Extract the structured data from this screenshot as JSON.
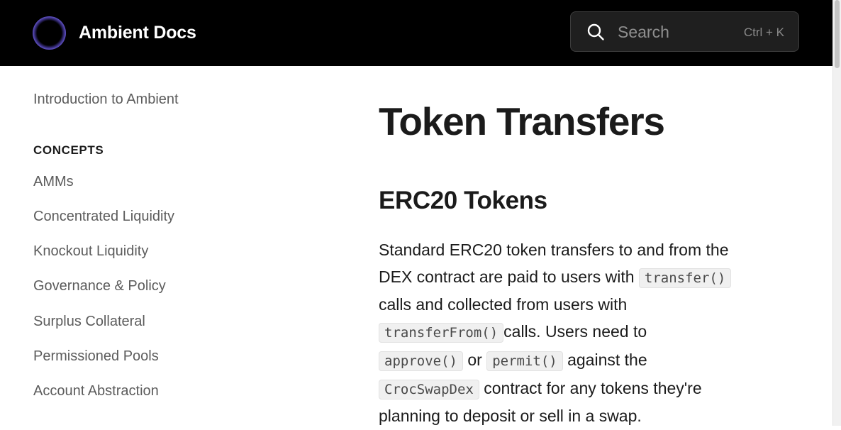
{
  "header": {
    "brand": "Ambient Docs",
    "search": {
      "placeholder": "Search",
      "shortcut": "Ctrl + K"
    }
  },
  "sidebar": {
    "intro": "Introduction to Ambient",
    "section_title": "CONCEPTS",
    "items": [
      "AMMs",
      "Concentrated Liquidity",
      "Knockout Liquidity",
      "Governance & Policy",
      "Surplus Collateral",
      "Permissioned Pools",
      "Account Abstraction"
    ]
  },
  "main": {
    "title": "Token Transfers",
    "section": "ERC20 Tokens",
    "paragraph": {
      "t1": "Standard ERC20 token transfers to and from the DEX contract are paid to users with",
      "c1": "transfer()",
      "t2": "calls and collected from users with",
      "c2": "transferFrom()",
      "t3": "calls. Users need to",
      "c3": "approve()",
      "t4": "or",
      "c4": "permit()",
      "t5": "against the",
      "c5": "CrocSwapDex",
      "t6": "contract for any tokens they're planning to deposit or sell in a swap."
    }
  },
  "colors": {
    "header_bg": "#000000",
    "text": "#1b1b1b",
    "sidebar_text": "#5c5c5c",
    "code_bg": "#f0f0f0"
  },
  "icons": {
    "logo": "ambient-ring-logo",
    "search": "search-icon"
  }
}
